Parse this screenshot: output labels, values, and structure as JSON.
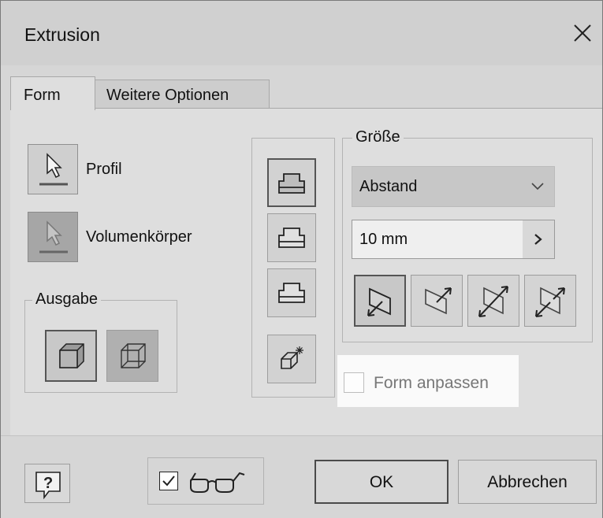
{
  "window": {
    "title": "Extrusion"
  },
  "tabs": [
    {
      "label": "Form",
      "active": true
    },
    {
      "label": "Weitere Optionen",
      "active": false
    }
  ],
  "profile": {
    "label": "Profil"
  },
  "solid": {
    "label": "Volumenkörper"
  },
  "output": {
    "legend": "Ausgabe",
    "options": [
      {
        "icon": "solid-cube-icon",
        "active": true
      },
      {
        "icon": "surface-cube-icon",
        "active": false
      }
    ]
  },
  "extent_types": [
    {
      "icon": "new-solid-icon",
      "active": true
    },
    {
      "icon": "join-icon",
      "active": false
    },
    {
      "icon": "cut-icon",
      "active": false
    },
    {
      "icon": "intersect-icon",
      "active": false
    }
  ],
  "size": {
    "legend": "Größe",
    "type_value": "Abstand",
    "distance_value": "10 mm",
    "directions": [
      {
        "icon": "direction-default-icon",
        "active": true
      },
      {
        "icon": "direction-flipped-icon",
        "active": false
      },
      {
        "icon": "direction-symmetric-icon",
        "active": false
      },
      {
        "icon": "direction-asymmetric-icon",
        "active": false
      }
    ]
  },
  "fit_form": {
    "label": "Form anpassen",
    "checked": false
  },
  "footer": {
    "help_icon": "?",
    "preview_checked": true,
    "ok_label": "OK",
    "cancel_label": "Abbrechen"
  },
  "colors": {
    "dialog_bg": "#dedede",
    "titlebar_bg": "#d0d0d0",
    "field_bg": "#efefef"
  }
}
